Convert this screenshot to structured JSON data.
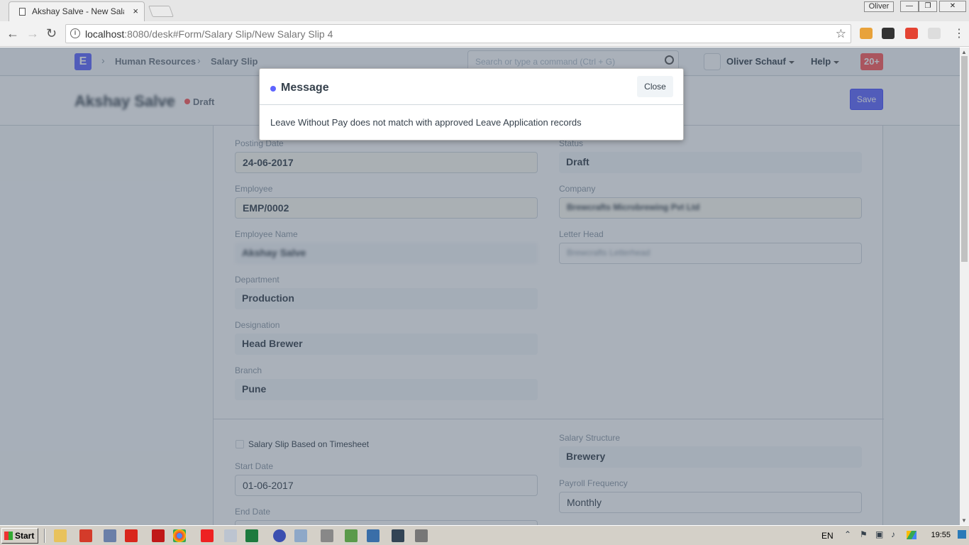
{
  "browser": {
    "tab_title": "Akshay Salve - New Salary",
    "tab_close": "×",
    "user_badge": "Oliver",
    "url_host": "localhost",
    "url_rest": ":8080/desk#Form/Salary Slip/New Salary Slip 4",
    "win_min": "—",
    "win_max": "❐",
    "win_close": "✕"
  },
  "navbar": {
    "logo": "E",
    "breadcrumbs": [
      "Human Resources",
      "Salary Slip"
    ],
    "search_placeholder": "Search or type a command (Ctrl + G)",
    "user": "Oliver Schauf",
    "help": "Help",
    "notifications": "20+"
  },
  "page": {
    "title": "Akshay Salve",
    "status": "Draft",
    "save": "Save"
  },
  "form": {
    "posting_date": {
      "label": "Posting Date",
      "value": "24-06-2017"
    },
    "employee": {
      "label": "Employee",
      "value": "EMP/0002"
    },
    "employee_name": {
      "label": "Employee Name",
      "value": "Akshay Salve"
    },
    "department": {
      "label": "Department",
      "value": "Production"
    },
    "designation": {
      "label": "Designation",
      "value": "Head Brewer"
    },
    "branch": {
      "label": "Branch",
      "value": "Pune"
    },
    "status": {
      "label": "Status",
      "value": "Draft"
    },
    "company": {
      "label": "Company",
      "value": "Brewcrafts Microbrewing Pvt Ltd"
    },
    "letter_head": {
      "label": "Letter Head",
      "value": "Brewcrafts Letterhead"
    },
    "timesheet": {
      "label": "Salary Slip Based on Timesheet"
    },
    "start_date": {
      "label": "Start Date",
      "value": "01-06-2017"
    },
    "end_date": {
      "label": "End Date",
      "value": ""
    },
    "salary_structure": {
      "label": "Salary Structure",
      "value": "Brewery"
    },
    "payroll_frequency": {
      "label": "Payroll Frequency",
      "value": "Monthly"
    }
  },
  "modal": {
    "title": "Message",
    "close": "Close",
    "body": "Leave Without Pay does not match with approved Leave Application records"
  },
  "taskbar": {
    "start": "Start",
    "lang": "EN",
    "clock": "19:55"
  },
  "colors": {
    "primary": "#5e64ff",
    "danger": "#ff5858"
  }
}
